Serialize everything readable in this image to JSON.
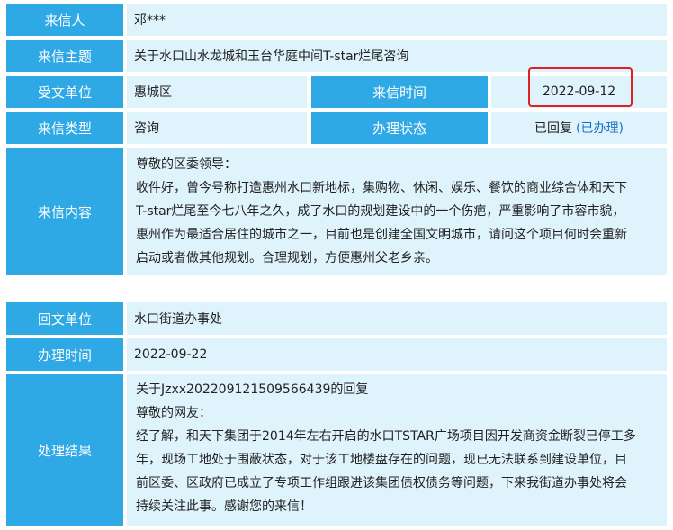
{
  "letter": {
    "sender_label": "来信人",
    "sender_value": "邓***",
    "subject_label": "来信主题",
    "subject_value": "关于水口山水龙城和玉台华庭中间T-star烂尾咨询",
    "dept_label": "受文单位",
    "dept_value": "惠城区",
    "time_label": "来信时间",
    "time_value": "2022-09-12",
    "type_label": "来信类型",
    "type_value": "咨询",
    "status_label": "办理状态",
    "status_value": "已回复",
    "status_link": "(已办理)",
    "content_label": "来信内容",
    "content_lines": [
      "尊敬的区委领导：",
      "收件好，曾今号称打造惠州水口新地标，集购物、休闲、娱乐、餐饮的商业综合体和天下",
      "T-star烂尾至今七八年之久，成了水口的规划建设中的一个伤疤，严重影响了市容市貌，",
      "惠州作为最适合居住的城市之一，目前也是创建全国文明城市，请问这个项目何时会重新",
      "启动或者做其他规划。合理规划，方便惠州父老乡亲。"
    ]
  },
  "reply": {
    "unit_label": "回文单位",
    "unit_value": "水口街道办事处",
    "time_label": "办理时间",
    "time_value": "2022-09-22",
    "result_label": "处理结果",
    "result_lines": [
      "关于Jzxx20220912150956​6439的回复",
      "尊敬的网友：",
      "经了解，和天下集团于2014年左右开启的水口TSTAR广场项目因开发商资金断裂已停工多",
      "年，现场工地处于围蔽状态，对于该工地楼盘存在的问题，现已无法联系到建设单位，目",
      "前区委、区政府已成立了专项工作组跟进该集团债权债务等问题，下来我街道办事处将会",
      "持续关注此事。感谢您的来信！"
    ]
  },
  "colors": {
    "label_bg": "#2fa8e6",
    "value_bg": "#dff3fc",
    "highlight": "#e02020",
    "link": "#1a6fc7"
  }
}
